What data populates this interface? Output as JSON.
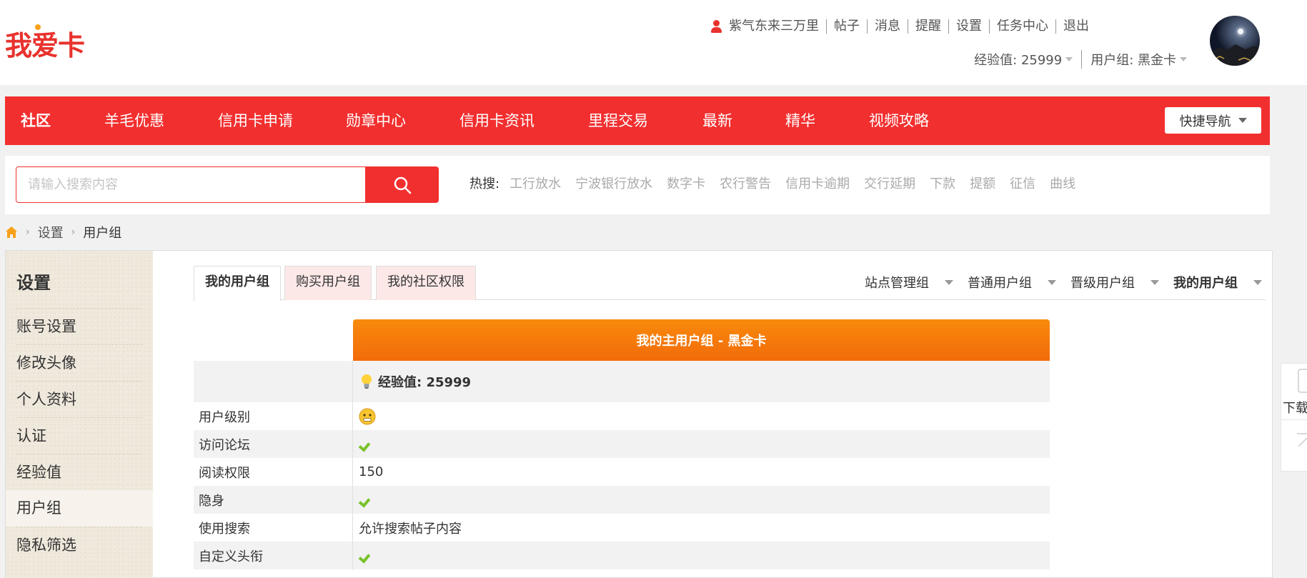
{
  "header": {
    "logo_text": "我爱卡",
    "username": "紫气东来三万里",
    "top_links": [
      "帖子",
      "消息",
      "提醒",
      "设置",
      "任务中心",
      "退出"
    ],
    "exp_label": "经验值: 25999",
    "group_label": "用户组: 黑金卡"
  },
  "nav": {
    "items": [
      "社区",
      "羊毛优惠",
      "信用卡申请",
      "勋章中心",
      "信用卡资讯",
      "里程交易",
      "最新",
      "精华",
      "视频攻略"
    ],
    "quick_nav": "快捷导航"
  },
  "search": {
    "placeholder": "请输入搜索内容",
    "hot_label": "热搜:",
    "hot_items": [
      "工行放水",
      "宁波银行放水",
      "数字卡",
      "农行警告",
      "信用卡逾期",
      "交行延期",
      "下款",
      "提额",
      "征信",
      "曲线"
    ]
  },
  "breadcrumb": {
    "items": [
      "设置",
      "用户组"
    ]
  },
  "sidebar": {
    "title": "设置",
    "items": [
      "账号设置",
      "修改头像",
      "个人资料",
      "认证",
      "经验值",
      "用户组",
      "隐私筛选"
    ]
  },
  "tabs": {
    "left": [
      "我的用户组",
      "购买用户组",
      "我的社区权限"
    ],
    "right": [
      "站点管理组",
      "普通用户组",
      "晋级用户组",
      "我的用户组"
    ]
  },
  "group": {
    "title": "我的主用户组 - 黑金卡",
    "exp": "经验值: 25999",
    "rows": [
      {
        "label": "用户级别",
        "value": ""
      },
      {
        "label": "访问论坛",
        "value": ""
      },
      {
        "label": "阅读权限",
        "value": "150"
      },
      {
        "label": "隐身",
        "value": ""
      },
      {
        "label": "使用搜索",
        "value": "允许搜索帖子内容"
      },
      {
        "label": "自定义头衔",
        "value": ""
      }
    ]
  },
  "float_widget": {
    "download": "下载"
  },
  "colors": {
    "brand_red": "#f22f2f",
    "header_orange": "#f57a0b",
    "check_green": "#78c22a"
  }
}
